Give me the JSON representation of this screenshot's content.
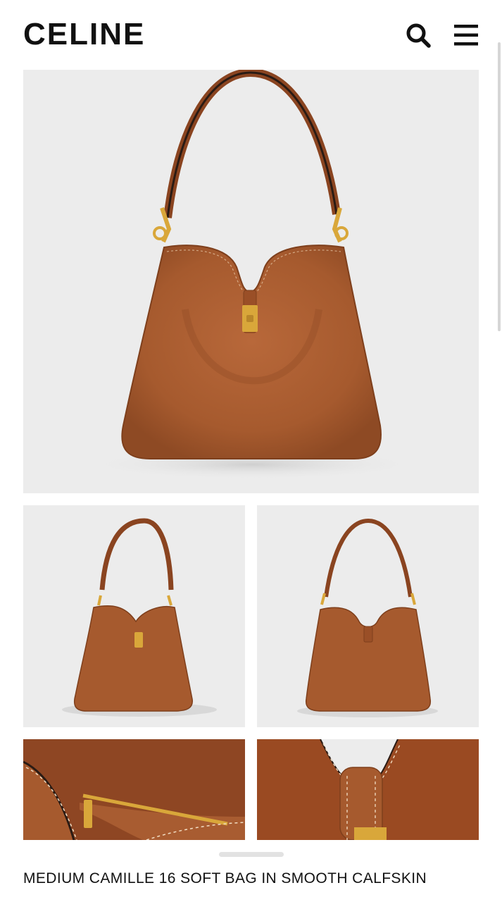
{
  "header": {
    "logo": "CELINE",
    "search_icon": "search-icon",
    "menu_icon": "hamburger-menu-icon"
  },
  "gallery": {
    "images": [
      {
        "name": "front-view"
      },
      {
        "name": "three-quarter-view"
      },
      {
        "name": "back-view"
      },
      {
        "name": "interior-zip-pocket-detail"
      },
      {
        "name": "clasp-closure-detail"
      }
    ]
  },
  "product": {
    "title": "MEDIUM CAMILLE 16 SOFT BAG IN SMOOTH CALFSKIN"
  },
  "colors": {
    "leather": "#a65a2e",
    "leather_dark": "#7e3f1c",
    "hardware": "#d9a73a",
    "photo_bg": "#ececec",
    "strap_edge": "#2a1b14"
  }
}
